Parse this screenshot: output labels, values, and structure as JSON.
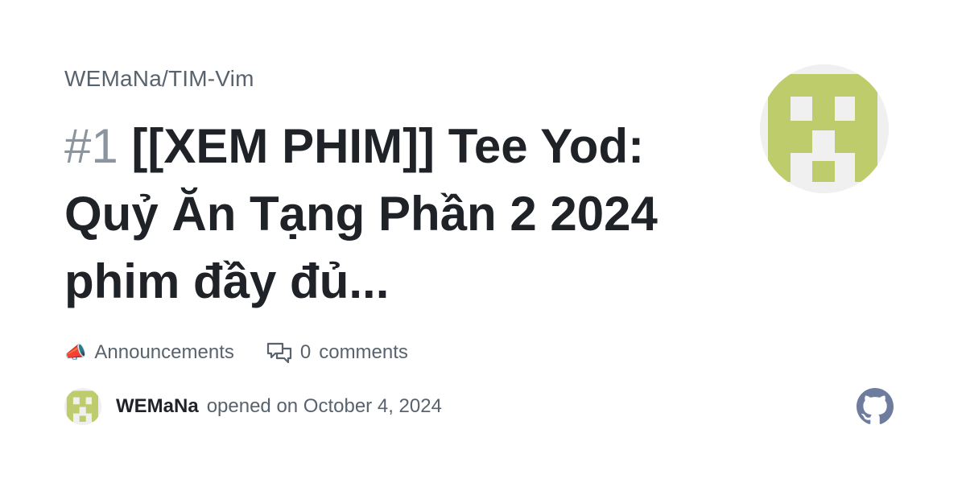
{
  "repo": {
    "full_name": "WEMaNa/TIM-Vim"
  },
  "issue": {
    "number": "#1",
    "title": "[[XEM PHIM]] Tee Yod: Quỷ Ăn Tạng Phần 2 2024 phim đầy đủ..."
  },
  "meta": {
    "category_emoji": "📣",
    "category": "Announcements",
    "comment_icon": "comment-discussion-icon",
    "comment_count": "0",
    "comment_label": "comments"
  },
  "author": {
    "username": "WEMaNa",
    "opened_text": "opened on October 4, 2024"
  },
  "icons": {
    "avatar": "identicon",
    "brand": "github-icon"
  },
  "colors": {
    "identicon": "#bfcc6c",
    "identicon_bg": "#f0f0f0",
    "title": "#1f2328",
    "muted": "#59636e",
    "number": "#8c959f",
    "github_logo": "#6e7d9e"
  }
}
